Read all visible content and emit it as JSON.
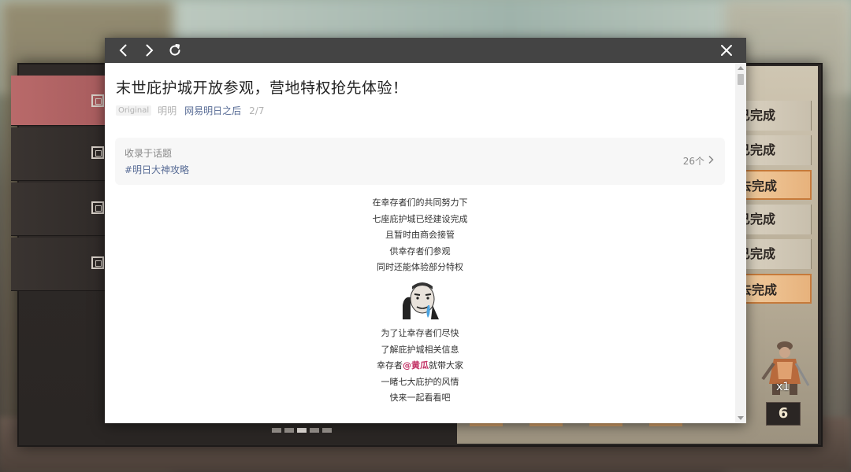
{
  "game": {
    "statuses": [
      {
        "text": "已完成",
        "highlight": false
      },
      {
        "text": "已完成",
        "highlight": false
      },
      {
        "text": "去完成",
        "highlight": true
      },
      {
        "text": "已完成",
        "highlight": false
      },
      {
        "text": "已完成",
        "highlight": false
      },
      {
        "text": "去完成",
        "highlight": true
      }
    ],
    "reward_qty": "x1",
    "count": "6"
  },
  "toolbar": {
    "back_icon": "chevron-left-icon",
    "forward_icon": "chevron-right-icon",
    "refresh_icon": "refresh-icon",
    "close_icon": "close-icon"
  },
  "article": {
    "title": "末世庇护城开放参观，营地特权抢先体验！",
    "tag": "Original",
    "author": "明明",
    "account": "网易明日之后",
    "page": "2/7",
    "topic": {
      "label": "收录于话题",
      "tag": "#明日大神攻略",
      "count": "26个"
    },
    "lines_a": [
      "在幸存者们的共同努力下",
      "七座庇护城已经建设完成",
      "且暂时由商会接管",
      "供幸存者们参观",
      "同时还能体验部分特权"
    ],
    "lines_b": [
      "为了让幸存者们尽快",
      "了解庇护城相关信息"
    ],
    "mention_line": {
      "prefix": "幸存者",
      "mention": "@黄瓜",
      "suffix": "就带大家"
    },
    "lines_c": [
      "一睹七大庇护的风情",
      "快来一起看看吧"
    ]
  },
  "colors": {
    "toolbar_bg": "#444444",
    "link": "#576b95",
    "mention": "#c23164",
    "active_tab": "#b96a6a"
  }
}
